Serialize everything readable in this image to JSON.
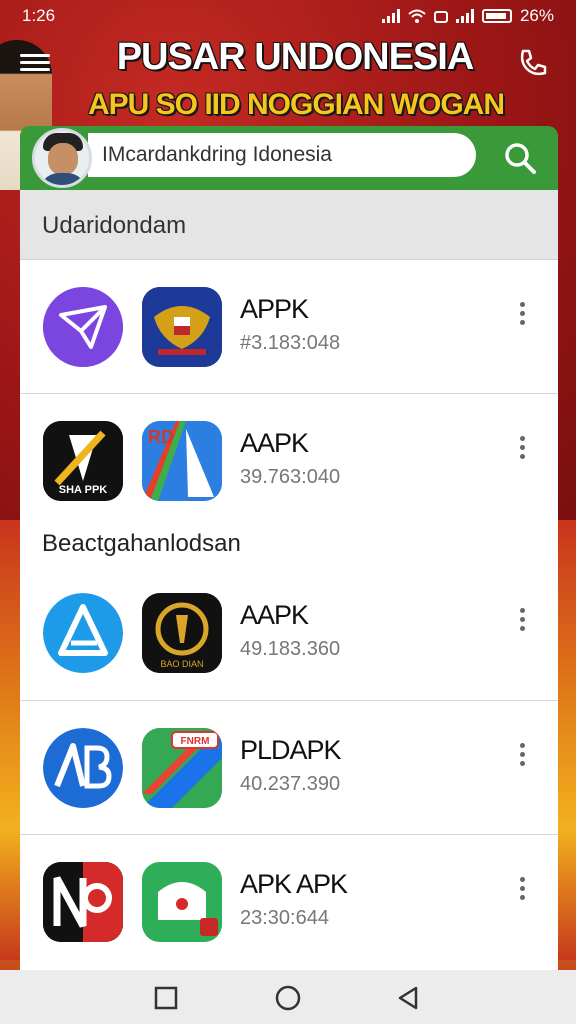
{
  "status_bar": {
    "time": "1:26",
    "battery_text": "26%"
  },
  "header": {
    "title_line1": "PUSAR UNDONESIA",
    "title_line2": "APU SO IID NOGGIAN WOGAN",
    "menu_icon": "hamburger-icon",
    "call_icon": "phone-icon"
  },
  "search": {
    "value": "IMcardankdring Idonesia",
    "placeholder": "",
    "search_icon": "search-icon"
  },
  "section": {
    "title": "Udaridondam"
  },
  "subsection": {
    "title": "Beactgahanlodsan"
  },
  "apps": [
    {
      "title": "APPK",
      "subtitle": "#3.183:048"
    },
    {
      "title": "AAPK",
      "subtitle": "39.763:040"
    },
    {
      "title": "AAPK",
      "subtitle": "49.183.360"
    },
    {
      "title": "PLDAPK",
      "subtitle": "40.237.390"
    },
    {
      "title": "APK APK",
      "subtitle": "23:30:644"
    }
  ],
  "icon_texts": {
    "sha": "SHA PPK",
    "rd": "RD",
    "bottom_badge": "BAO DIAN",
    "fnrm": "FNRM"
  },
  "colors": {
    "accent_green": "#3a9a3a",
    "banner_red": "#b21d1d",
    "banner_gold": "#f7c51c"
  },
  "nav": {
    "recent_icon": "square-icon",
    "home_icon": "circle-icon",
    "back_icon": "triangle-back-icon"
  }
}
